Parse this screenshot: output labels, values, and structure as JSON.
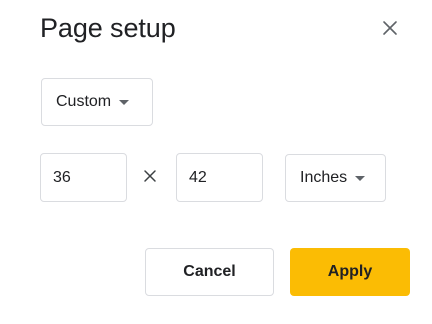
{
  "dialog": {
    "title": "Page setup",
    "close_icon": "close-icon"
  },
  "preset": {
    "selected": "Custom",
    "caret_icon": "caret-down-icon"
  },
  "dimensions": {
    "width_value": "36",
    "height_value": "42",
    "times_icon": "times-icon"
  },
  "units": {
    "selected": "Inches",
    "caret_icon": "caret-down-icon"
  },
  "actions": {
    "cancel_label": "Cancel",
    "apply_label": "Apply"
  },
  "colors": {
    "apply_bg": "#fbbc04",
    "apply_text": "#202124",
    "border": "#dadce0",
    "icon": "#5f6368"
  }
}
